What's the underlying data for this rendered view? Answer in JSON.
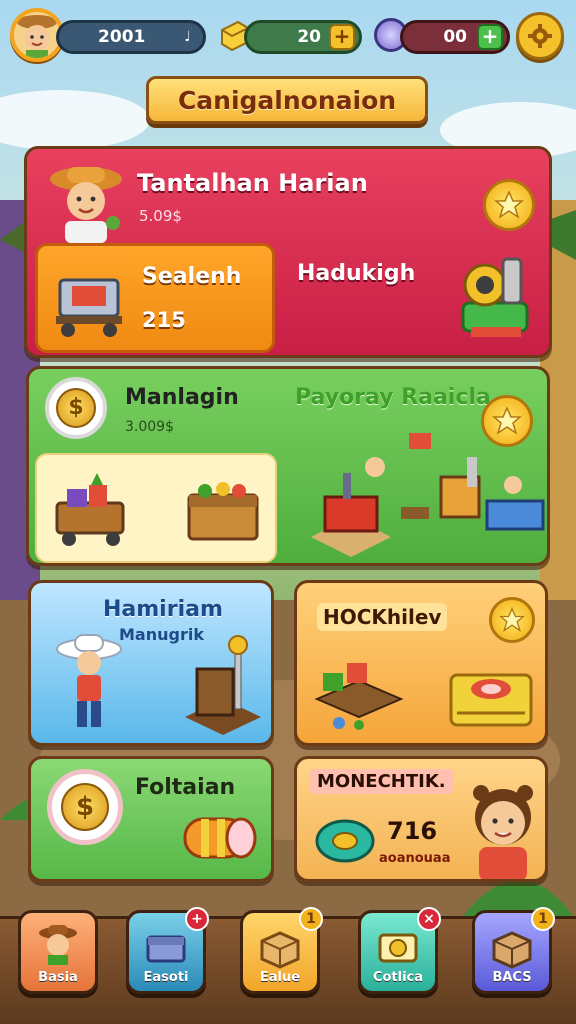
{
  "hud": {
    "player_score": "2001",
    "score_icon": "horn-icon",
    "gold_value": "20",
    "gems_value": "00",
    "settings_icon": "gear-icon"
  },
  "title": "Canigalnonaion",
  "panels": {
    "daily": {
      "title": "Tantalhan Harian",
      "value": "5.09$",
      "sub_card_title": "Sealenh",
      "sub_card_value": "215",
      "right_title": "Hadukigh"
    },
    "management": {
      "title": "Manlagin",
      "value": "3.009$",
      "right_title": "Payoray Raaicla"
    },
    "harvest": {
      "title": "Hamiriam",
      "subtitle": "Manugrik"
    },
    "shop": {
      "title": "HOCKhilev"
    },
    "fortune": {
      "title": "Foltaian"
    },
    "merchant": {
      "title": "MONECHTIK.",
      "value": "716",
      "subtitle": "aoanouaa"
    }
  },
  "nav": [
    {
      "label": "Basia",
      "icon": "farmer-icon",
      "badge": ""
    },
    {
      "label": "Easoti",
      "icon": "chest-icon",
      "badge": "+"
    },
    {
      "label": "Ealue",
      "icon": "box-icon",
      "badge": "1"
    },
    {
      "label": "Cotlica",
      "icon": "coin-icon",
      "badge": "×"
    },
    {
      "label": "BACS",
      "icon": "package-icon",
      "badge": "1"
    }
  ],
  "colors": {
    "daily_panel": "#d6294f",
    "management_panel": "#5fbf4c",
    "harvest_panel": "#5ab8ea",
    "shop_panel": "#f5a53a",
    "fortune_panel": "#57b848",
    "merchant_panel": "#f3b253",
    "accent_gold": "#f4c12a"
  }
}
